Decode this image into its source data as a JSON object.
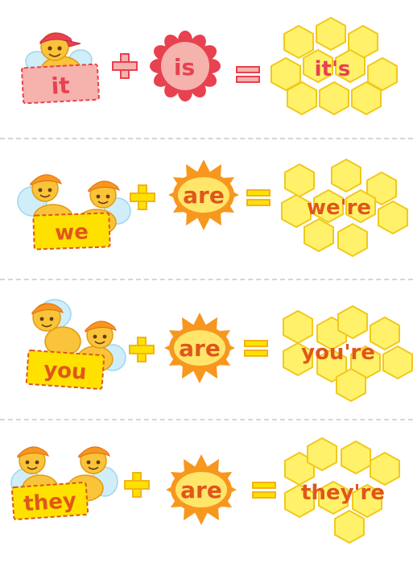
{
  "rows": [
    {
      "pronoun": "it",
      "verb": "is",
      "contraction": "it's",
      "bees": 1,
      "theme": "red"
    },
    {
      "pronoun": "we",
      "verb": "are",
      "contraction": "we're",
      "bees": 2,
      "theme": "yellow"
    },
    {
      "pronoun": "you",
      "verb": "are",
      "contraction": "you're",
      "bees": 2,
      "theme": "yellow"
    },
    {
      "pronoun": "they",
      "verb": "are",
      "contraction": "they're",
      "bees": 2,
      "theme": "yellow"
    }
  ],
  "operators": {
    "plus": "+",
    "equals": "="
  },
  "colors": {
    "red_accent": "#e8414f",
    "pink_sign": "#f6b2ad",
    "orange_text": "#e0561a",
    "orange_sun": "#f7971e",
    "yellow_sign": "#ffe100",
    "honey_fill": "#fff26a",
    "honey_stroke": "#f2c81b",
    "bee_body": "#f9c43a",
    "wing": "#cfeefa"
  },
  "icons": [
    "bee-icon",
    "plus-icon",
    "flower-icon",
    "sun-icon",
    "equals-icon",
    "honeycomb-icon"
  ]
}
